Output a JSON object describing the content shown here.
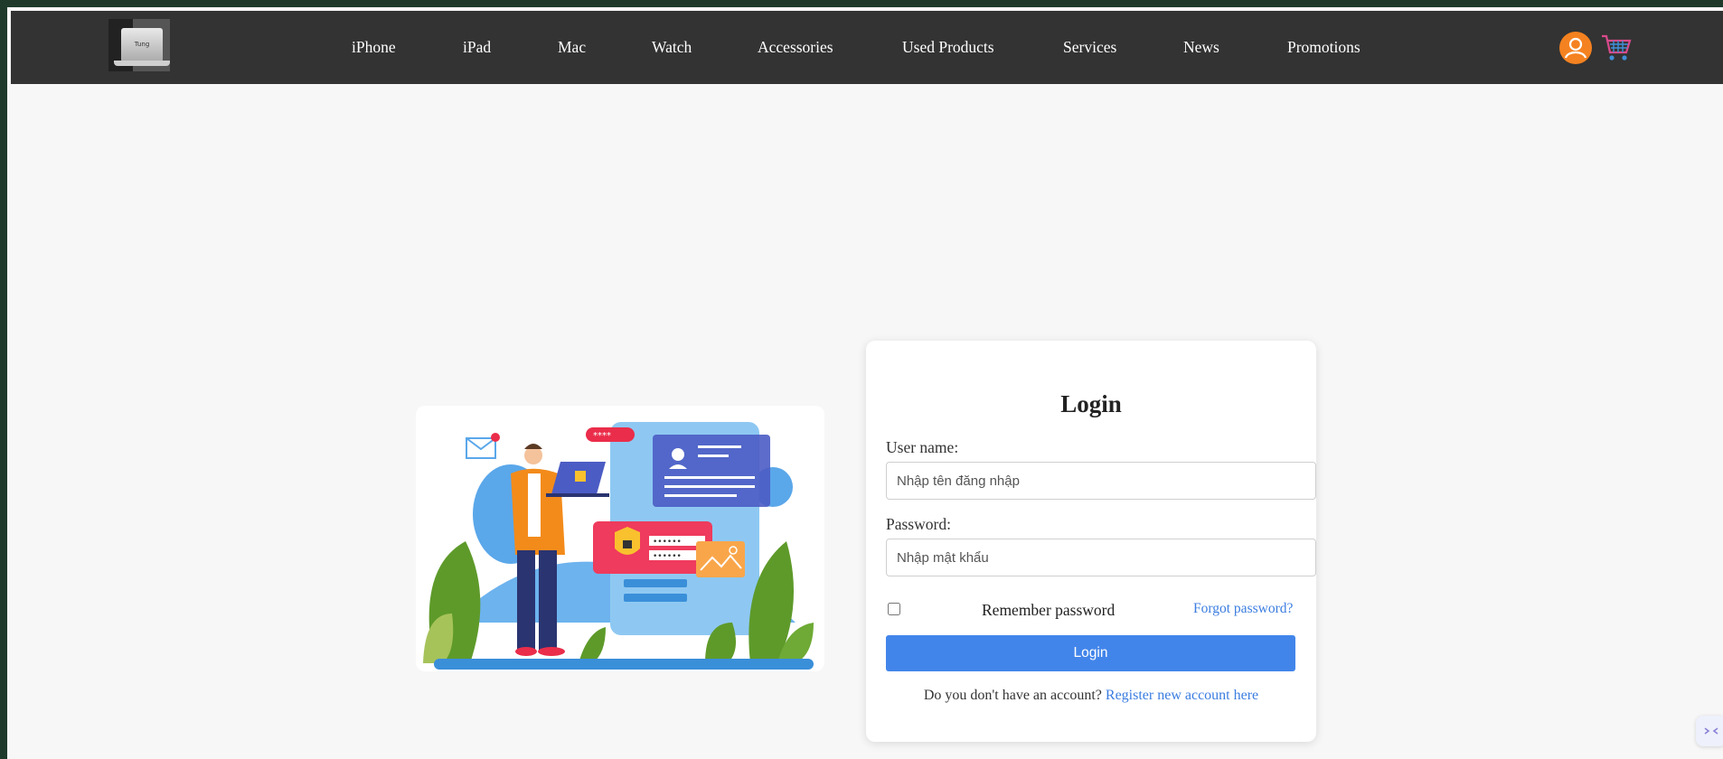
{
  "nav": {
    "logo_text": "Tung",
    "items": [
      "iPhone",
      "iPad",
      "Mac",
      "Watch",
      "Accessories",
      "Used Products",
      "Services",
      "News",
      "Promotions"
    ]
  },
  "illustration": {
    "bubble_text": "****",
    "password_dots": "••••••"
  },
  "login": {
    "title": "Login",
    "username_label": "User name:",
    "username_placeholder": "Nhập tên đăng nhập",
    "password_label": "Password:",
    "password_placeholder": "Nhập mật khẩu",
    "remember_label": "Remember password",
    "forgot_link": "Forgot password?",
    "button_label": "Login",
    "register_prompt": "Do you don't have an account?",
    "register_link": "Register new account here"
  },
  "colors": {
    "header_bg": "#333333",
    "page_bg": "#f7f7f7",
    "accent": "#4285ea",
    "link": "#3b7de0",
    "user_icon": "#f58220"
  },
  "icons": {
    "user": "user-circle-icon",
    "cart": "shopping-cart-icon"
  }
}
